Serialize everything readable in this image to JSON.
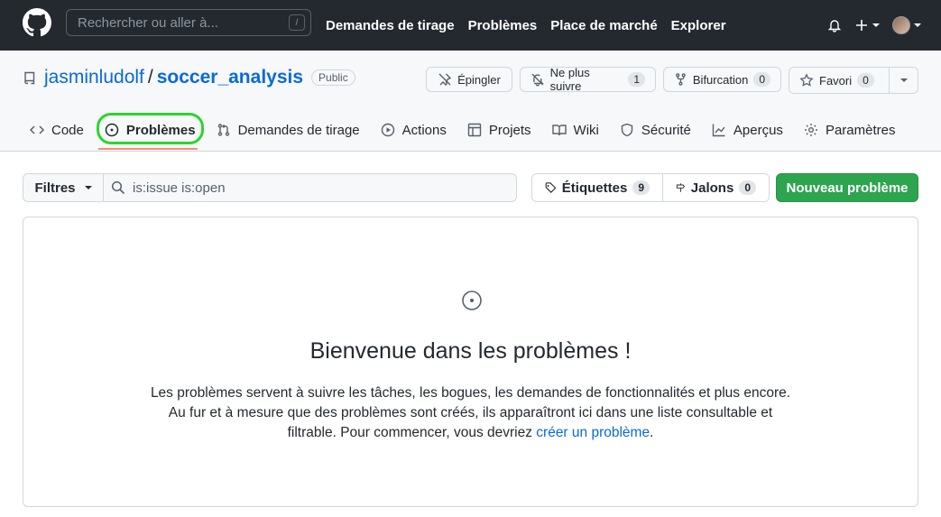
{
  "header": {
    "search_placeholder": "Rechercher ou aller à...",
    "search_shortcut": "/",
    "nav": [
      "Demandes de tirage",
      "Problèmes",
      "Place de marché",
      "Explorer"
    ]
  },
  "repo": {
    "owner": "jasminludolf",
    "separator": "/",
    "name": "soccer_analysis",
    "visibility": "Public",
    "actions": {
      "pin_label": "Épingler",
      "unwatch_label": "Ne plus suivre",
      "unwatch_count": "1",
      "fork_label": "Bifurcation",
      "fork_count": "0",
      "star_label": "Favori",
      "star_count": "0"
    }
  },
  "tabs": {
    "code": "Code",
    "issues": "Problèmes",
    "pulls": "Demandes de tirage",
    "actions": "Actions",
    "projects": "Projets",
    "wiki": "Wiki",
    "security": "Sécurité",
    "insights": "Aperçus",
    "settings": "Paramètres"
  },
  "filterbar": {
    "filters_label": "Filtres",
    "query": "is:issue is:open",
    "labels_label": "Étiquettes",
    "labels_count": "9",
    "milestones_label": "Jalons",
    "milestones_count": "0",
    "new_issue_label": "Nouveau problème"
  },
  "blankslate": {
    "title": "Bienvenue dans les problèmes !",
    "text": "Les problèmes servent à suivre les tâches, les bogues, les demandes de fonctionnalités et plus encore. Au fur et à mesure que des problèmes sont créés, ils apparaîtront ici dans une liste consultable et filtrable. Pour commencer, vous devriez ",
    "link": "créer un problème",
    "text_end": "."
  },
  "colors": {
    "header_bg": "#24292f",
    "link": "#0969da",
    "primary": "#2da44e",
    "highlight_ring": "#2bd52b",
    "tab_underline": "#fd8c73"
  }
}
